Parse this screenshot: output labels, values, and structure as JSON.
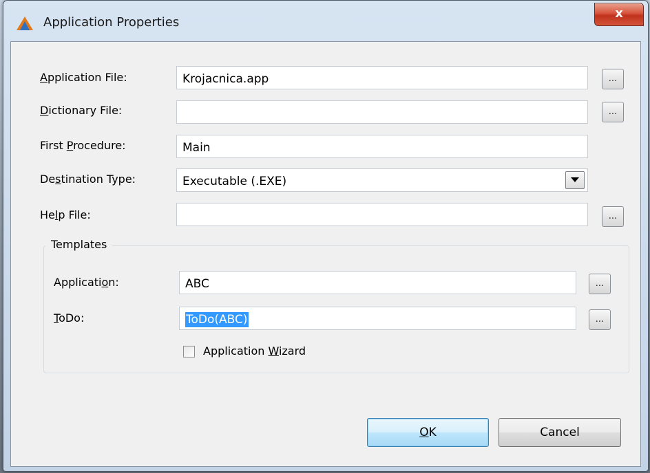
{
  "window": {
    "title": "Application Properties",
    "close_label": "x"
  },
  "form": {
    "application_file": {
      "label_pre": "",
      "label_mnemonic": "A",
      "label_post": "pplication File:",
      "value": "Krojacnica.app"
    },
    "dictionary_file": {
      "label_pre": "",
      "label_mnemonic": "D",
      "label_post": "ictionary File:",
      "value": ""
    },
    "first_procedure": {
      "label_pre": "First ",
      "label_mnemonic": "P",
      "label_post": "rocedure:",
      "value": "Main"
    },
    "destination_type": {
      "label_pre": "De",
      "label_mnemonic": "s",
      "label_post": "tination Type:",
      "value": "Executable (.EXE)"
    },
    "help_file": {
      "label_pre": "He",
      "label_mnemonic": "l",
      "label_post": "p File:",
      "value": ""
    },
    "browse_label": "..."
  },
  "templates": {
    "group_title": "Templates",
    "application": {
      "label_pre": "Applicati",
      "label_mnemonic": "o",
      "label_post": "n:",
      "value": "ABC"
    },
    "todo": {
      "label_pre": "",
      "label_mnemonic": "T",
      "label_post": "oDo:",
      "value": "ToDo(ABC)"
    },
    "wizard": {
      "label_pre": "Application ",
      "label_mnemonic": "W",
      "label_post": "izard",
      "checked": false
    }
  },
  "buttons": {
    "ok_mnemonic": "O",
    "ok_rest": "K",
    "cancel": "Cancel"
  },
  "colors": {
    "selection": "#3399ff",
    "close_button": "#c7432a"
  }
}
